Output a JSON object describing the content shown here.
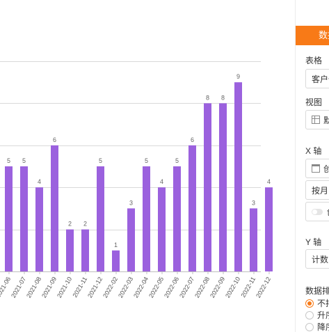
{
  "chart_data": {
    "type": "bar",
    "categories": [
      "2021-06",
      "2021-07",
      "2021-08",
      "2021-09",
      "2021-10",
      "2021-11",
      "2021-12",
      "2022-02",
      "2022-03",
      "2022-04",
      "2022-05",
      "2022-06",
      "2022-07",
      "2022-08",
      "2022-09",
      "2022-10",
      "2022-11",
      "2022-12"
    ],
    "values": [
      5,
      5,
      4,
      6,
      2,
      2,
      5,
      1,
      3,
      5,
      4,
      5,
      6,
      8,
      8,
      9,
      3,
      4
    ],
    "title": "",
    "xlabel": "",
    "ylabel": "",
    "ylim": [
      0,
      10
    ],
    "grid": true,
    "bar_color": "#9b61de"
  },
  "panel": {
    "header": "数据",
    "table_label": "表格",
    "table_value": "客户信",
    "view_label": "视图",
    "view_value": "默",
    "x_axis_label": "X 轴",
    "x_field_value": "创",
    "x_group_value": "按月",
    "x_toggle_label": "创",
    "y_axis_label": "Y 轴",
    "y_value": "计数",
    "sort_label": "数据排",
    "sort_options": [
      "不排",
      "升序",
      "降序"
    ],
    "sort_selected": 0,
    "accent_color": "#f87a17",
    "icons": {
      "table": "table-icon",
      "field": "calendar-icon",
      "toggle": "toggle-switch"
    }
  }
}
